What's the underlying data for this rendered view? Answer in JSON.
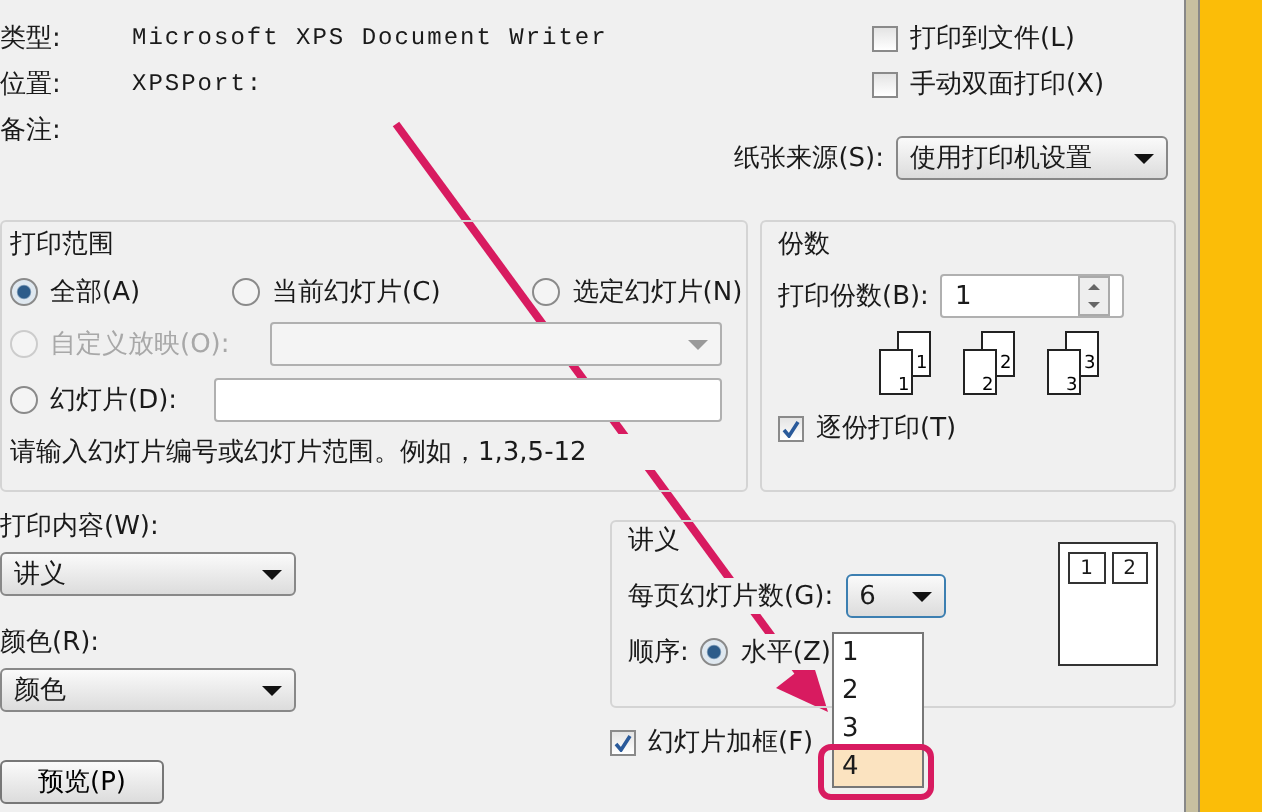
{
  "printer_info": [
    {
      "label": "类型:",
      "value": "Microsoft XPS Document Writer"
    },
    {
      "label": "位置:",
      "value": "XPSPort:"
    },
    {
      "label": "备注:"
    }
  ],
  "options": [
    {
      "label": "打印到文件(L)",
      "checked": false
    },
    {
      "label": "手动双面打印(X)",
      "checked": false
    }
  ],
  "paper_source": {
    "label": "纸张来源(S):",
    "value": "使用打印机设置"
  },
  "print_range": {
    "title": "打印范围",
    "options": [
      {
        "kind": "plain",
        "label": "全部(A)",
        "selected": true,
        "disabled": false
      },
      {
        "kind": "plain",
        "label": "当前幻灯片(C)",
        "selected": false,
        "disabled": false
      },
      {
        "kind": "plain",
        "label": "选定幻灯片(N)",
        "selected": false,
        "disabled": false
      },
      {
        "kind": "dropdown",
        "label": "自定义放映(O):",
        "selected": false,
        "disabled": true
      },
      {
        "kind": "input",
        "label": "幻灯片(D):",
        "selected": false,
        "disabled": false
      }
    ],
    "hint": "请输入幻灯片编号或幻灯片范围。例如，1,3,5-12"
  },
  "copies": {
    "title": "份数",
    "label": "打印份数(B):",
    "value": "1",
    "collate_pages": [
      {
        "back": "1",
        "front": "1"
      },
      {
        "back": "2",
        "front": "2"
      },
      {
        "back": "3",
        "front": "3"
      }
    ],
    "collate": {
      "label": "逐份打印(T)",
      "checked": true
    }
  },
  "print_what": {
    "label": "打印内容(W):",
    "value": "讲义"
  },
  "color": {
    "label": "颜色(R):",
    "value": "颜色"
  },
  "handouts": {
    "title": "讲义",
    "per_page_label": "每页幻灯片数(G):",
    "per_page_value": "6",
    "dropdown_items": [
      {
        "label": "1",
        "selected": false
      },
      {
        "label": "2",
        "selected": false
      },
      {
        "label": "3",
        "selected": false
      },
      {
        "label": "4",
        "selected": true
      }
    ],
    "order_label": "顺序:",
    "order_options": [
      {
        "label": "水平(Z)",
        "selected": true
      }
    ],
    "preview_numbers": [
      "1",
      "2"
    ]
  },
  "frame": {
    "label": "幻灯片加框(F)",
    "checked": true
  },
  "buttons": [
    "预览(P)"
  ]
}
